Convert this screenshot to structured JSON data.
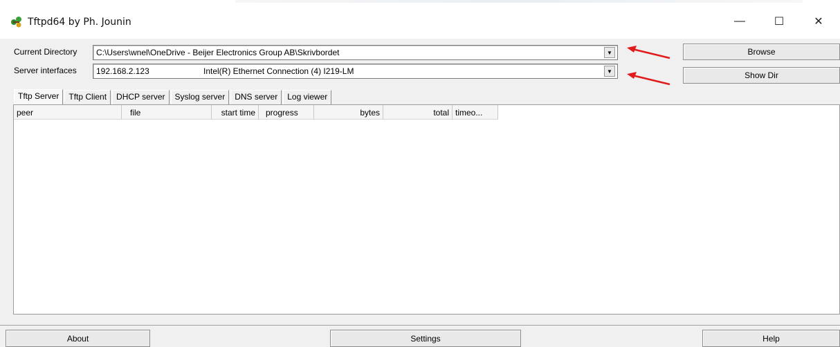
{
  "window": {
    "title": "Tftpd64 by Ph. Jounin",
    "minimize_glyph": "—",
    "maximize_glyph": "☐",
    "close_glyph": "✕"
  },
  "directory": {
    "label": "Current Directory",
    "value": "C:\\Users\\wnel\\OneDrive - Beijer Electronics Group AB\\Skrivbordet"
  },
  "interfaces": {
    "label": "Server interfaces",
    "ip": "192.168.2.123",
    "adapter": "Intel(R) Ethernet Connection (4) I219-LM"
  },
  "buttons": {
    "browse": "Browse",
    "show_dir": "Show Dir",
    "about": "About",
    "settings": "Settings",
    "help": "Help"
  },
  "tabs": [
    {
      "label": "Tftp Server"
    },
    {
      "label": "Tftp Client"
    },
    {
      "label": "DHCP server"
    },
    {
      "label": "Syslog server"
    },
    {
      "label": "DNS server"
    },
    {
      "label": "Log viewer"
    }
  ],
  "columns": [
    {
      "label": "peer"
    },
    {
      "label": "file"
    },
    {
      "label": "start time"
    },
    {
      "label": "progress"
    },
    {
      "label": "bytes"
    },
    {
      "label": "total"
    },
    {
      "label": "timeo..."
    }
  ],
  "colors": {
    "annotation_arrow": "#e11b1b",
    "window_bg": "#f0f0f0"
  },
  "icons": {
    "app": "tftpd-app-icon",
    "dropdown": "chevron-down-icon"
  }
}
